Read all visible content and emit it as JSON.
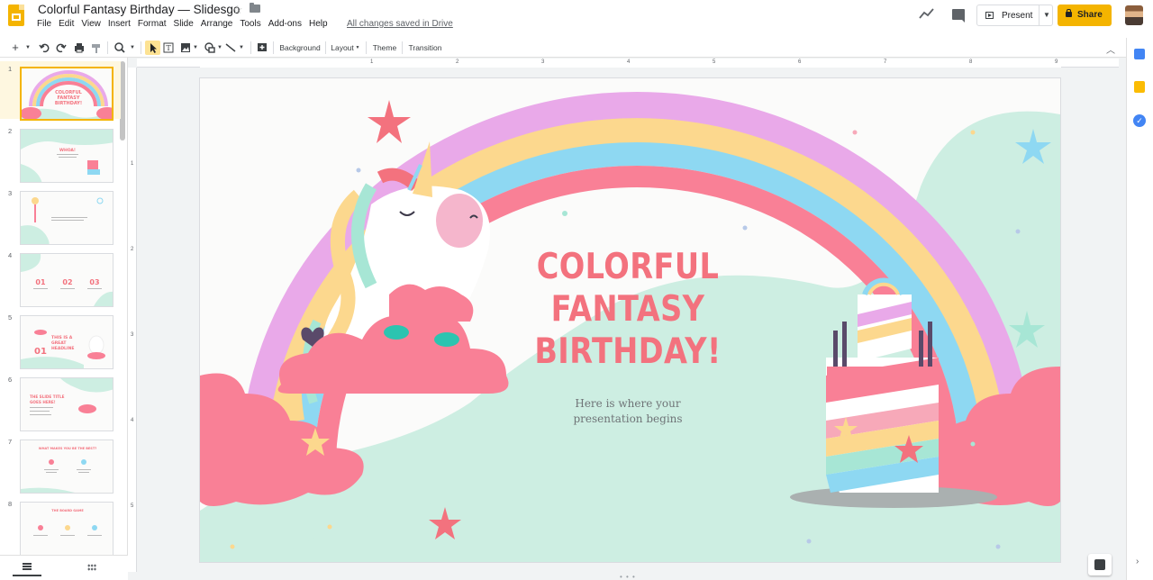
{
  "header": {
    "doc_title": "Colorful Fantasy Birthday — Slidesgo",
    "saved_status": "All changes saved in Drive",
    "menu": [
      "File",
      "Edit",
      "View",
      "Insert",
      "Format",
      "Slide",
      "Arrange",
      "Tools",
      "Add-ons",
      "Help"
    ],
    "present_label": "Present",
    "share_label": "Share"
  },
  "toolbar": {
    "background_label": "Background",
    "layout_label": "Layout",
    "theme_label": "Theme",
    "transition_label": "Transition"
  },
  "ruler": {
    "h_marks": [
      "1",
      "2",
      "3",
      "4",
      "5",
      "6",
      "7",
      "8",
      "9"
    ],
    "v_marks": [
      "1",
      "2",
      "3",
      "4",
      "5"
    ]
  },
  "filmstrip": {
    "slides": [
      {
        "num": "1",
        "label": "COLORFUL FANTASY BIRTHDAY!"
      },
      {
        "num": "2",
        "label": "WHOA!"
      },
      {
        "num": "3",
        "label": ""
      },
      {
        "num": "4",
        "label": "01 02 03"
      },
      {
        "num": "5",
        "label": "THIS IS A GREAT HEADLINE"
      },
      {
        "num": "6",
        "label": "THE SLIDE TITLE GOES HERE!"
      },
      {
        "num": "7",
        "label": "WHAT MAKES YOU BE THE BEST?"
      },
      {
        "num": "8",
        "label": "THE BOARD GAME"
      }
    ],
    "thumb_nums": {
      "s4a": "01",
      "s4b": "02",
      "s4c": "03",
      "s5": "01"
    }
  },
  "slide": {
    "title_line1": "COLORFUL",
    "title_line2": "FANTASY",
    "title_line3": "BIRTHDAY!",
    "subtitle_line1": "Here is where your",
    "subtitle_line2": "presentation begins"
  },
  "colors": {
    "title": "#f3727e",
    "rainbow_outer": "#e9a9e9",
    "rainbow_yellow": "#fcd88e",
    "rainbow_blue": "#8ed8f2",
    "rainbow_pink": "#f98096",
    "mint": "#cdeee2",
    "share": "#f4b400"
  },
  "icons": [
    "trend-icon",
    "comment-icon",
    "present-icon",
    "lock-icon",
    "star-icon",
    "folder-icon"
  ]
}
